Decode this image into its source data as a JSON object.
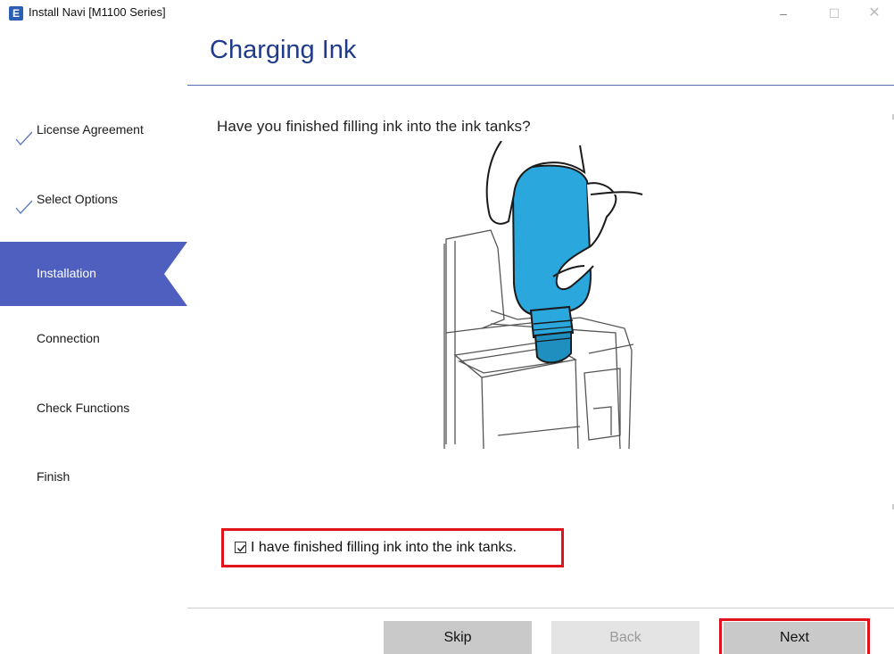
{
  "window": {
    "title": "Install Navi [M1100 Series]",
    "icon_letter": "E",
    "minimize": "–",
    "maximize": "☐",
    "close": "✕"
  },
  "header": {
    "title": "Charging Ink"
  },
  "sidebar": {
    "items": [
      {
        "label": "License Agreement",
        "state": "done"
      },
      {
        "label": "Select Options",
        "state": "done"
      },
      {
        "label": "Installation",
        "state": "active"
      },
      {
        "label": "Connection",
        "state": "pending"
      },
      {
        "label": "Check Functions",
        "state": "pending"
      },
      {
        "label": "Finish",
        "state": "pending"
      }
    ]
  },
  "main": {
    "question": "Have you finished filling ink into the ink tanks?",
    "confirm": {
      "label": "I have finished filling ink into the ink tanks.",
      "checked": true
    }
  },
  "footer": {
    "skip_label": "Skip",
    "back_label": "Back",
    "next_label": "Next"
  },
  "colors": {
    "accent": "#4e5fbf",
    "title": "#1f3b8c",
    "highlight": "#e0121b",
    "ink": "#2aa7dc"
  }
}
